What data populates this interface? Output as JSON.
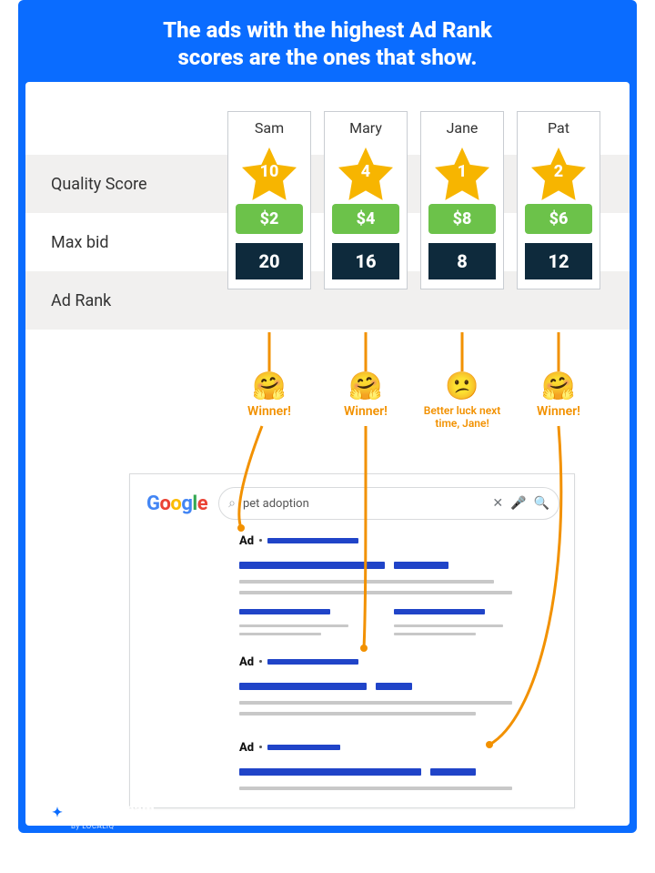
{
  "header": {
    "title_line1": "The ads with the highest Ad Rank",
    "title_line2": "scores are the ones that show."
  },
  "row_labels": {
    "quality": "Quality Score",
    "max_bid": "Max bid",
    "ad_rank": "Ad Rank"
  },
  "advertisers": [
    {
      "name": "Sam",
      "quality_score": "10",
      "max_bid": "$2",
      "ad_rank": "20",
      "emoji": "🤗",
      "outcome": "Winner!"
    },
    {
      "name": "Mary",
      "quality_score": "4",
      "max_bid": "$4",
      "ad_rank": "16",
      "emoji": "🤗",
      "outcome": "Winner!"
    },
    {
      "name": "Jane",
      "quality_score": "1",
      "max_bid": "$8",
      "ad_rank": "8",
      "emoji": "😕",
      "outcome": "Better luck next time, Jane!"
    },
    {
      "name": "Pat",
      "quality_score": "2",
      "max_bid": "$6",
      "ad_rank": "12",
      "emoji": "🤗",
      "outcome": "Winner!"
    }
  ],
  "serp": {
    "query": "pet adoption",
    "ad_label": "Ad"
  },
  "footer": {
    "brand": "WordStream",
    "byline": "By LOCALiQ"
  }
}
